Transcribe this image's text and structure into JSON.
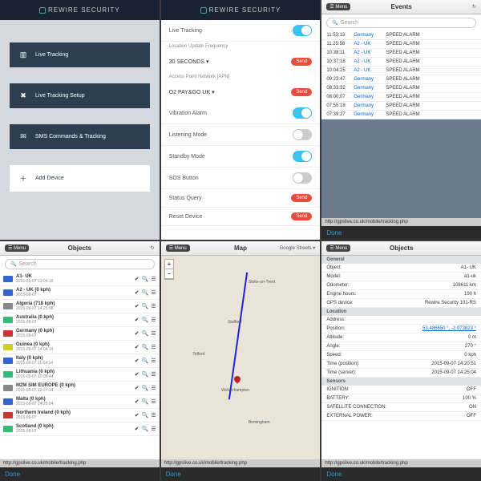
{
  "brand": "REWIRE SECURITY",
  "s1": {
    "b1": "Live Tracking",
    "b2": "Live Tracking Setup",
    "b3": "SMS Commands & Tracking",
    "b4": "Add Device"
  },
  "s2": {
    "liveTracking": "Live Tracking",
    "freqLabel": "Location Update Frequency",
    "freqValue": "30 SECONDS",
    "apnLabel": "Access Point Network [APN]",
    "apnValue": "O2 PAY&GO UK",
    "vibration": "Vibration Alarm",
    "listening": "Listening Mode",
    "standby": "Standby Mode",
    "sos": "SOS Button",
    "status": "Status Query",
    "reset": "Reset Device",
    "send": "Send"
  },
  "ios": {
    "menu": "☰ Menu",
    "search": "Search",
    "done": "Done",
    "url": "http://gpslive.co.uk/mobile/tracking.php"
  },
  "events": {
    "title": "Events",
    "rows": [
      {
        "t": "11:53:13",
        "d": "Germany",
        "m": "SPEED ALARM"
      },
      {
        "t": "11:25:58",
        "d": "A2 - UK",
        "m": "SPEED ALARM"
      },
      {
        "t": "10:38:11",
        "d": "A2 - UK",
        "m": "SPEED ALARM"
      },
      {
        "t": "10:37:18",
        "d": "A2 - UK",
        "m": "SPEED ALARM"
      },
      {
        "t": "10:04:25",
        "d": "A2 - UK",
        "m": "SPEED ALARM"
      },
      {
        "t": "09:23:47",
        "d": "Germany",
        "m": "SPEED ALARM"
      },
      {
        "t": "08:33:32",
        "d": "Germany",
        "m": "SPEED ALARM"
      },
      {
        "t": "08:00:07",
        "d": "Germany",
        "m": "SPEED ALARM"
      },
      {
        "t": "07:55:18",
        "d": "Germany",
        "m": "SPEED ALARM"
      },
      {
        "t": "07:39:27",
        "d": "Germany",
        "m": "SPEED ALARM"
      }
    ]
  },
  "objects": {
    "title": "Objects",
    "rows": [
      {
        "c": "b",
        "n": "A1- UK",
        "m": "2015-09-07 13:04:19"
      },
      {
        "c": "b",
        "n": "A2 - UK (0 kph)",
        "m": "2015-09-07"
      },
      {
        "c": "gy",
        "n": "Algeria (718 kph)",
        "m": "2015-09-07 14:25:08"
      },
      {
        "c": "g",
        "n": "Australia (0 kph)",
        "m": "2015-09-07"
      },
      {
        "c": "r",
        "n": "Germany (0 kph)",
        "m": "2015-09-07"
      },
      {
        "c": "y",
        "n": "Guinea (0 kph)",
        "m": "2015-09-07 14:04:14"
      },
      {
        "c": "b",
        "n": "Italy (0 kph)",
        "m": "2015-09-07 11:04:14"
      },
      {
        "c": "g",
        "n": "Lithuania (0 kph)",
        "m": "2015-09-07 13:08:44"
      },
      {
        "c": "gy",
        "n": "M2M SIM EUROPE (0 kph)",
        "m": "2015-09-07 13:27:14"
      },
      {
        "c": "b",
        "n": "Malta (0 kph)",
        "m": "2015-09-07 14:25:04"
      },
      {
        "c": "r",
        "n": "Northern Ireland (0 kph)",
        "m": "2015-09-07"
      },
      {
        "c": "g",
        "n": "Scotland (0 kph)",
        "m": "2015-09-07"
      }
    ]
  },
  "map": {
    "title": "Map",
    "style": "Google Streets",
    "cities": [
      "Stoke-on-Trent",
      "Stafford",
      "Telford",
      "Wolverhampton",
      "Birmingham"
    ]
  },
  "detail": {
    "title": "Objects",
    "general": "General",
    "object": {
      "k": "Object:",
      "v": "A1- UK"
    },
    "model": {
      "k": "Model:",
      "v": "a1-uk"
    },
    "odo": {
      "k": "Odometer:",
      "v": "108611 km"
    },
    "eng": {
      "k": "Engine hours:",
      "v": "190 h"
    },
    "gps": {
      "k": "GPS device:",
      "v": "Rewire Security 101-RS"
    },
    "location": "Location",
    "addr": {
      "k": "Address:",
      "v": ""
    },
    "pos": {
      "k": "Position:",
      "v": "53.486650 °, -2.073823 °"
    },
    "alt": {
      "k": "Altitude:",
      "v": "0 m"
    },
    "ang": {
      "k": "Angle:",
      "v": "270 °"
    },
    "spd": {
      "k": "Speed:",
      "v": "0 kph"
    },
    "tpos": {
      "k": "Time (position):",
      "v": "2015-09-07 14:20:51"
    },
    "tsrv": {
      "k": "Time (server):",
      "v": "2015-09-07 14:25:04"
    },
    "sensors": "Sensors",
    "ign": {
      "k": "IGNITION:",
      "v": "OFF"
    },
    "bat": {
      "k": "BATTERY:",
      "v": "100 %"
    },
    "sat": {
      "k": "SATELLITE CONNECTION:",
      "v": "ON"
    },
    "ext": {
      "k": "EXTERNAL POWER:",
      "v": "OFF"
    }
  }
}
